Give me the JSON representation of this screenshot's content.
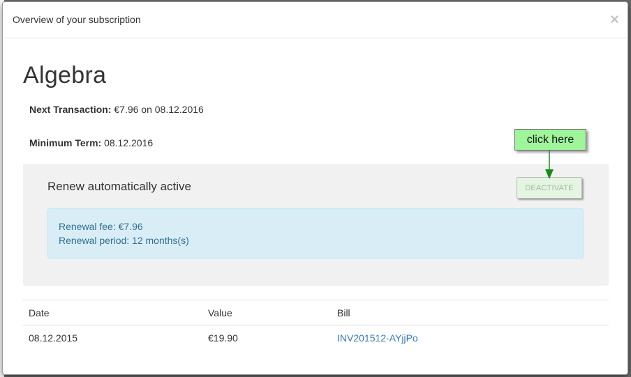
{
  "modal": {
    "title": "Overview of your subscription",
    "close_symbol": "×"
  },
  "subscription": {
    "name": "Algebra",
    "next_transaction_label": "Next Transaction:",
    "next_transaction_value": "€7.96 on 08.12.2016",
    "minimum_term_label": "Minimum Term:",
    "minimum_term_value": "08.12.2016"
  },
  "renewal": {
    "status": "Renew automatically active",
    "deactivate_label": "DEACTIVATE",
    "fee": "Renewal fee: €7.96",
    "period": "Renewal period: 12 months(s)"
  },
  "callout": {
    "text": "click here",
    "color": "#9ff59a",
    "arrow_color": "#1a8a1a"
  },
  "history": {
    "columns": [
      "Date",
      "Value",
      "Bill"
    ],
    "rows": [
      {
        "date": "08.12.2015",
        "value": "€19.90",
        "bill": "INV201512-AYjjPo"
      }
    ]
  }
}
